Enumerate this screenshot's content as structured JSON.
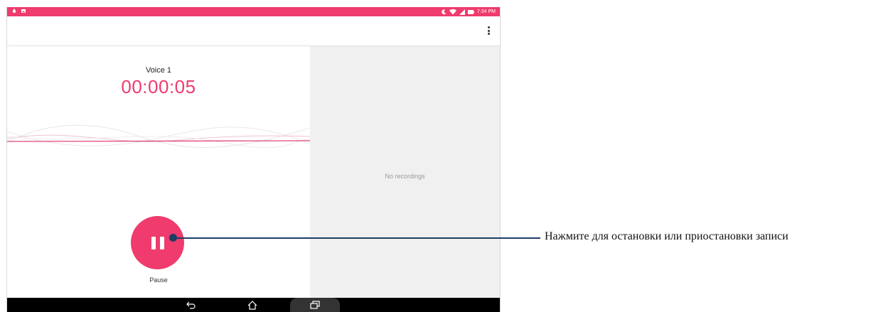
{
  "status_bar": {
    "time": "7:34 PM",
    "left_icons": [
      "flame-icon",
      "image-icon"
    ],
    "right_icons": [
      "moon-icon",
      "wifi-icon",
      "signal-icon",
      "battery-icon"
    ],
    "color": "#ef3b6d"
  },
  "app_bar": {
    "menu_icon": "more-vert-icon"
  },
  "recording": {
    "name": "Voice 1",
    "timer": "00:00:05",
    "accent_color": "#ef3b6d"
  },
  "controls": {
    "pause_label": "Pause",
    "pause_icon": "pause-icon"
  },
  "recordings_list": {
    "empty_message": "No recordings"
  },
  "nav_bar": {
    "icons": [
      "back-icon",
      "home-icon",
      "recents-icon"
    ]
  },
  "annotation": {
    "text": "Нажмите для остановки или приостановки записи",
    "color": "#1c3e63"
  }
}
